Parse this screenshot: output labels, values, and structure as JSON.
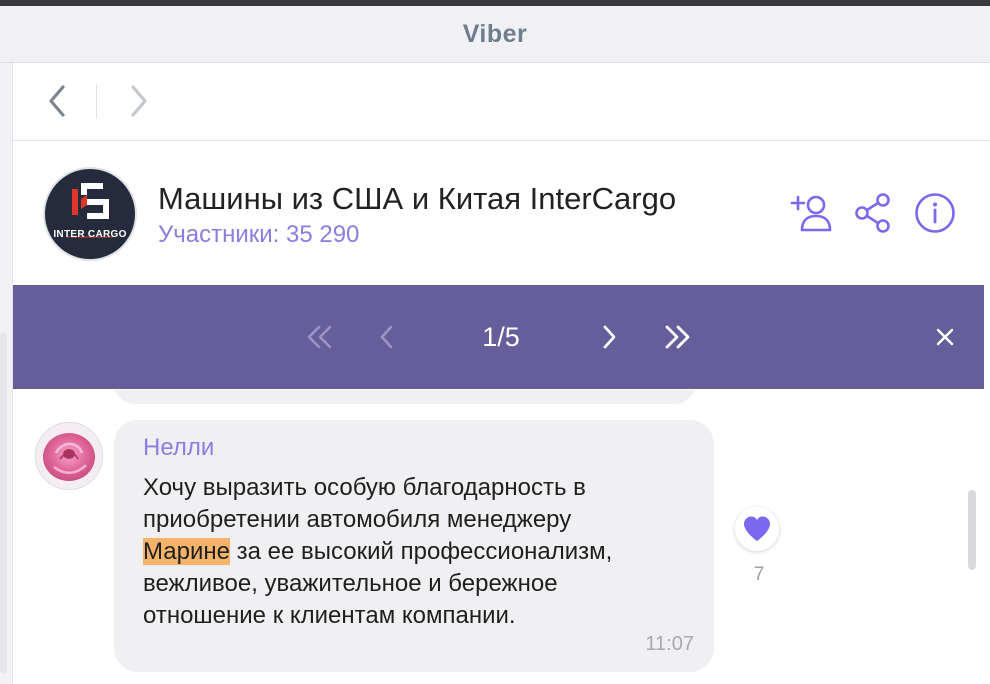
{
  "app": {
    "title": "Viber"
  },
  "nav": {
    "back_icon": "chevron-left-icon",
    "forward_icon": "chevron-right-icon"
  },
  "chat_header": {
    "name": "Машины из США и Китая InterCargo",
    "subtitle": "Участники: 35 290",
    "logo_text": "INTER CARGO",
    "icons": [
      "add-participant-icon",
      "share-icon",
      "info-icon"
    ],
    "accent_color": "#8b7ee0"
  },
  "search_bar": {
    "counter": "1/5",
    "background_color": "#665d9b",
    "buttons": [
      "first-result-icon",
      "previous-result-icon",
      "next-result-icon",
      "last-result-icon",
      "close-icon"
    ]
  },
  "message": {
    "sender": "Нелли",
    "lines": [
      "Хочу выразить особую благодарность в",
      "приобретении автомобиля менеджеру",
      "за ее высокий профессионализм,",
      "вежливое, уважительное и бережное",
      "отношение к клиентам компании."
    ],
    "highlighted_word": "Марине",
    "highlight_color": "#f6b46a",
    "time": "11:07",
    "reaction": {
      "icon": "heart-icon",
      "count": "7",
      "color": "#7b68ee"
    }
  }
}
